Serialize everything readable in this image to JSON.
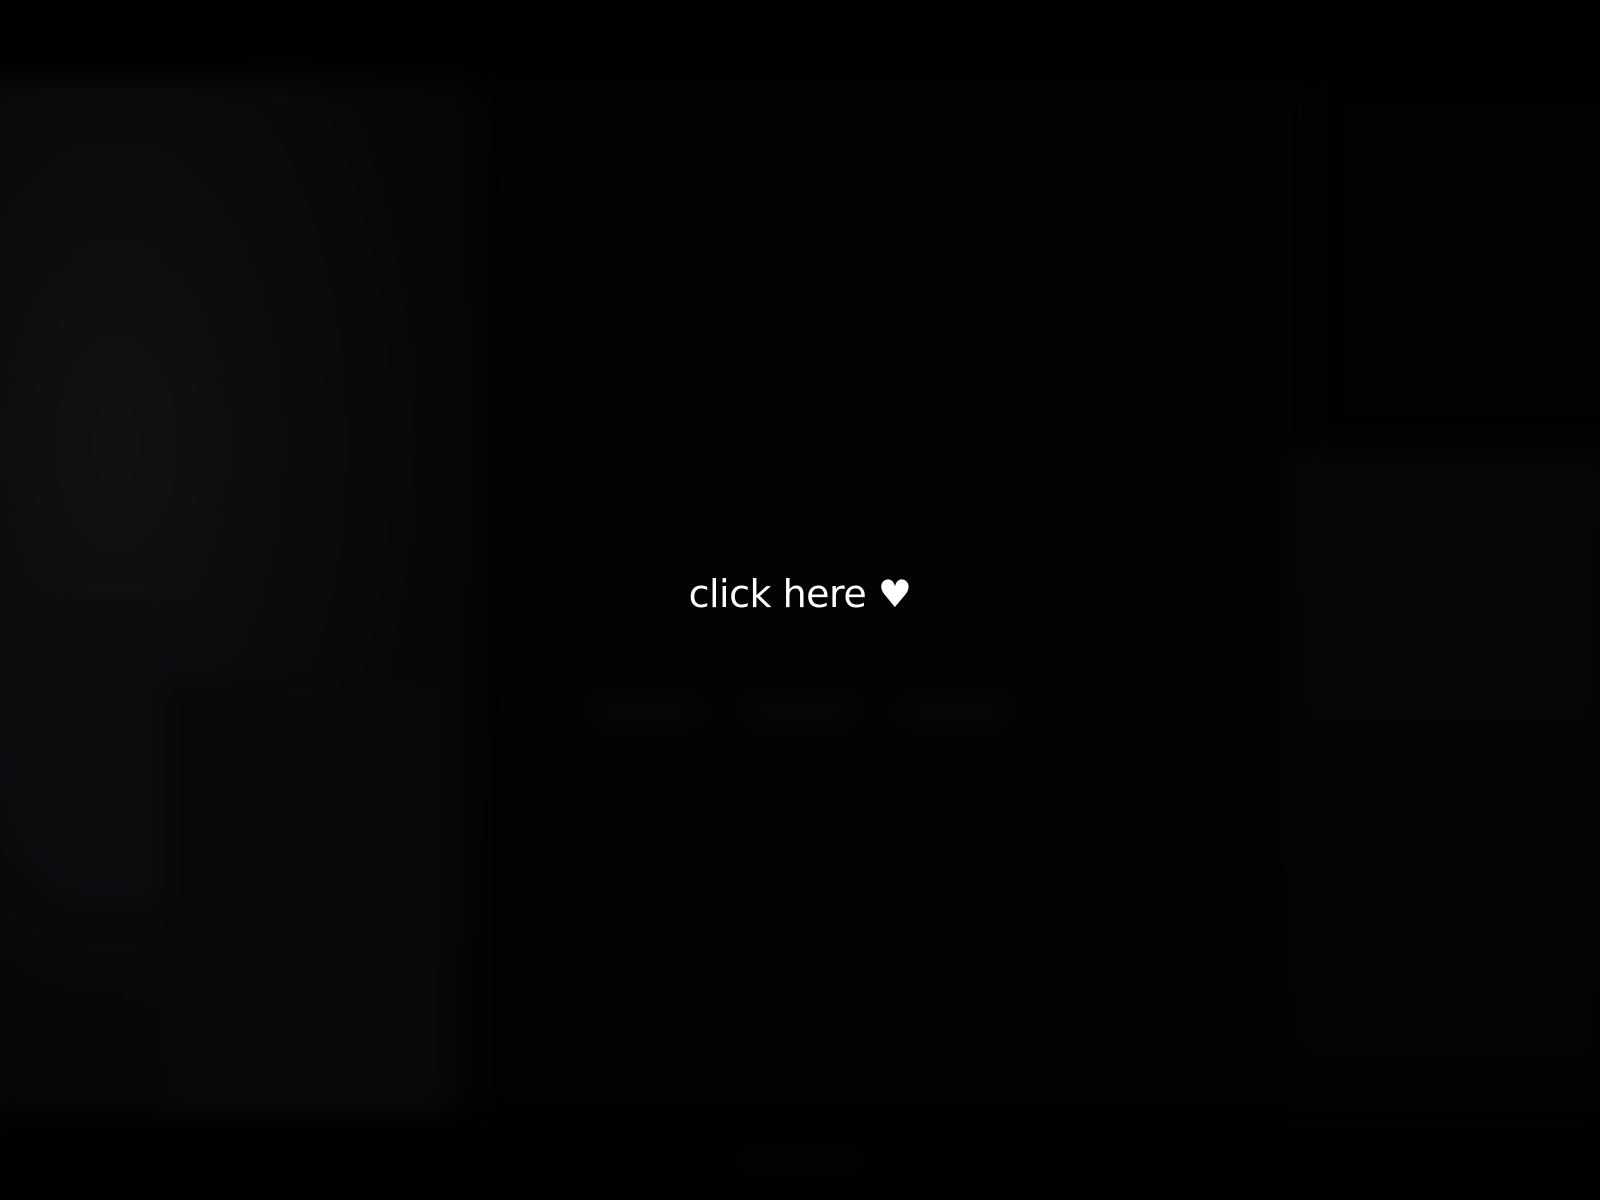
{
  "enter_overlay": {
    "prompt_text": "click here",
    "prompt_icon": "♥",
    "icon_name": "heart-icon",
    "text_color": "#ffffff",
    "overlay_color": "#000000"
  }
}
